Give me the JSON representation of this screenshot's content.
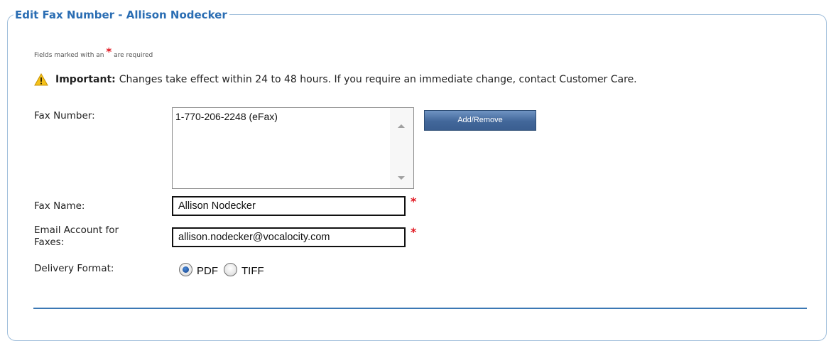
{
  "section": {
    "legend": "Edit Fax Number - Allison Nodecker"
  },
  "required_note": {
    "prefix": "Fields marked with an",
    "star": "*",
    "suffix": "are required"
  },
  "notice": {
    "icon": "warning-icon",
    "bold": "Important:",
    "text": "Changes take effect within 24 to 48 hours. If you require an immediate change, contact Customer Care."
  },
  "form": {
    "fax_number": {
      "label": "Fax Number:",
      "options": [
        "1-770-206-2248 (eFax)"
      ],
      "button_label": "Add/Remove"
    },
    "fax_name": {
      "label": "Fax Name:",
      "value": "Allison Nodecker",
      "required_star": "*"
    },
    "email": {
      "label_line1": "Email Account for",
      "label_line2": "Faxes:",
      "value": "allison.nodecker@vocalocity.com",
      "required_star": "*"
    },
    "delivery_format": {
      "label": "Delivery Format:",
      "options": [
        {
          "label": "PDF",
          "selected": true
        },
        {
          "label": "TIFF",
          "selected": false
        }
      ]
    }
  },
  "colors": {
    "legend_text": "#2a6db3",
    "border": "#9fbedb",
    "required": "#e0141e",
    "button_bg": "#42679a",
    "divider": "#3b78b4"
  }
}
